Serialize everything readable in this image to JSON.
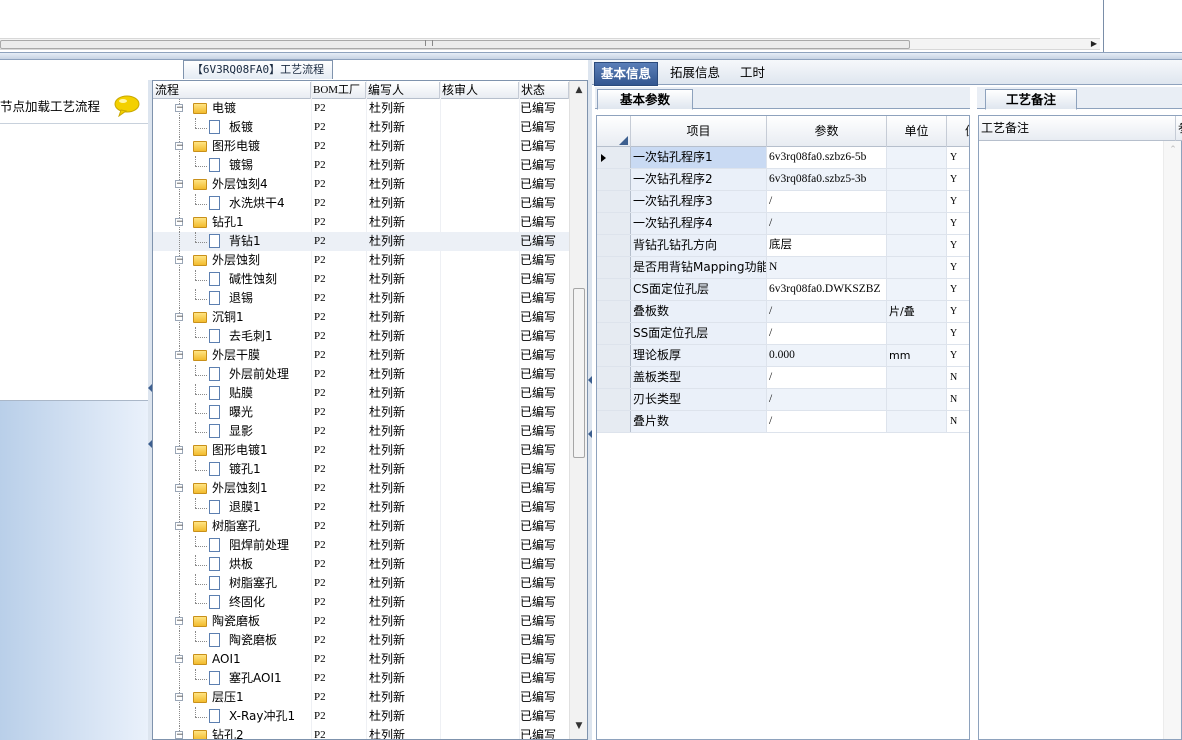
{
  "colors": {
    "frame_border": "#7f93ad",
    "tab_active_bg": "#3e639b",
    "tab_active_text": "#ffffff",
    "left_panel_gradient_start": "#b9cfe9",
    "folder_yellow": "#f2bb2d",
    "item_cell_bg": "#eaf0f9"
  },
  "left_panel": {
    "title": "节点加载工艺流程",
    "icon": "speech-bubble-icon"
  },
  "tree_panel": {
    "tab_label": "【6V3RQ08FA0】工艺流程",
    "columns": [
      "流程",
      "BOM工厂",
      "编写人",
      "核审人",
      "状态"
    ],
    "rows": [
      {
        "level": 1,
        "kind": "folder",
        "label": "电镀",
        "bom": "P2",
        "writer": "杜列新",
        "reviewer": "",
        "status": "已编写"
      },
      {
        "level": 2,
        "kind": "doc",
        "label": "板镀",
        "bom": "P2",
        "writer": "杜列新",
        "reviewer": "",
        "status": "已编写"
      },
      {
        "level": 1,
        "kind": "folder",
        "label": "图形电镀",
        "bom": "P2",
        "writer": "杜列新",
        "reviewer": "",
        "status": "已编写"
      },
      {
        "level": 2,
        "kind": "doc",
        "label": "镀锡",
        "bom": "P2",
        "writer": "杜列新",
        "reviewer": "",
        "status": "已编写"
      },
      {
        "level": 1,
        "kind": "folder",
        "label": "外层蚀刻4",
        "bom": "P2",
        "writer": "杜列新",
        "reviewer": "",
        "status": "已编写"
      },
      {
        "level": 2,
        "kind": "doc",
        "label": "水洗烘干4",
        "bom": "P2",
        "writer": "杜列新",
        "reviewer": "",
        "status": "已编写"
      },
      {
        "level": 1,
        "kind": "folder",
        "label": "钻孔1",
        "bom": "P2",
        "writer": "杜列新",
        "reviewer": "",
        "status": "已编写"
      },
      {
        "level": 2,
        "kind": "doc",
        "label": "背钻1",
        "bom": "P2",
        "writer": "杜列新",
        "reviewer": "",
        "status": "已编写",
        "selected": true
      },
      {
        "level": 1,
        "kind": "folder",
        "label": "外层蚀刻",
        "bom": "P2",
        "writer": "杜列新",
        "reviewer": "",
        "status": "已编写"
      },
      {
        "level": 2,
        "kind": "doc",
        "label": "碱性蚀刻",
        "bom": "P2",
        "writer": "杜列新",
        "reviewer": "",
        "status": "已编写"
      },
      {
        "level": 2,
        "kind": "doc",
        "label": "退锡",
        "bom": "P2",
        "writer": "杜列新",
        "reviewer": "",
        "status": "已编写"
      },
      {
        "level": 1,
        "kind": "folder",
        "label": "沉铜1",
        "bom": "P2",
        "writer": "杜列新",
        "reviewer": "",
        "status": "已编写"
      },
      {
        "level": 2,
        "kind": "doc",
        "label": "去毛刺1",
        "bom": "P2",
        "writer": "杜列新",
        "reviewer": "",
        "status": "已编写"
      },
      {
        "level": 1,
        "kind": "folder",
        "label": "外层干膜",
        "bom": "P2",
        "writer": "杜列新",
        "reviewer": "",
        "status": "已编写"
      },
      {
        "level": 2,
        "kind": "doc",
        "label": "外层前处理",
        "bom": "P2",
        "writer": "杜列新",
        "reviewer": "",
        "status": "已编写"
      },
      {
        "level": 2,
        "kind": "doc",
        "label": "贴膜",
        "bom": "P2",
        "writer": "杜列新",
        "reviewer": "",
        "status": "已编写"
      },
      {
        "level": 2,
        "kind": "doc",
        "label": "曝光",
        "bom": "P2",
        "writer": "杜列新",
        "reviewer": "",
        "status": "已编写"
      },
      {
        "level": 2,
        "kind": "doc",
        "label": "显影",
        "bom": "P2",
        "writer": "杜列新",
        "reviewer": "",
        "status": "已编写"
      },
      {
        "level": 1,
        "kind": "folder",
        "label": "图形电镀1",
        "bom": "P2",
        "writer": "杜列新",
        "reviewer": "",
        "status": "已编写"
      },
      {
        "level": 2,
        "kind": "doc",
        "label": "镀孔1",
        "bom": "P2",
        "writer": "杜列新",
        "reviewer": "",
        "status": "已编写"
      },
      {
        "level": 1,
        "kind": "folder",
        "label": "外层蚀刻1",
        "bom": "P2",
        "writer": "杜列新",
        "reviewer": "",
        "status": "已编写"
      },
      {
        "level": 2,
        "kind": "doc",
        "label": "退膜1",
        "bom": "P2",
        "writer": "杜列新",
        "reviewer": "",
        "status": "已编写"
      },
      {
        "level": 1,
        "kind": "folder",
        "label": "树脂塞孔",
        "bom": "P2",
        "writer": "杜列新",
        "reviewer": "",
        "status": "已编写"
      },
      {
        "level": 2,
        "kind": "doc",
        "label": "阻焊前处理",
        "bom": "P2",
        "writer": "杜列新",
        "reviewer": "",
        "status": "已编写"
      },
      {
        "level": 2,
        "kind": "doc",
        "label": "烘板",
        "bom": "P2",
        "writer": "杜列新",
        "reviewer": "",
        "status": "已编写"
      },
      {
        "level": 2,
        "kind": "doc",
        "label": "树脂塞孔",
        "bom": "P2",
        "writer": "杜列新",
        "reviewer": "",
        "status": "已编写"
      },
      {
        "level": 2,
        "kind": "doc",
        "label": "终固化",
        "bom": "P2",
        "writer": "杜列新",
        "reviewer": "",
        "status": "已编写"
      },
      {
        "level": 1,
        "kind": "folder",
        "label": "陶瓷磨板",
        "bom": "P2",
        "writer": "杜列新",
        "reviewer": "",
        "status": "已编写"
      },
      {
        "level": 2,
        "kind": "doc",
        "label": "陶瓷磨板",
        "bom": "P2",
        "writer": "杜列新",
        "reviewer": "",
        "status": "已编写"
      },
      {
        "level": 1,
        "kind": "folder",
        "label": "AOI1",
        "bom": "P2",
        "writer": "杜列新",
        "reviewer": "",
        "status": "已编写"
      },
      {
        "level": 2,
        "kind": "doc",
        "label": "塞孔AOI1",
        "bom": "P2",
        "writer": "杜列新",
        "reviewer": "",
        "status": "已编写"
      },
      {
        "level": 1,
        "kind": "folder",
        "label": "层压1",
        "bom": "P2",
        "writer": "杜列新",
        "reviewer": "",
        "status": "已编写"
      },
      {
        "level": 2,
        "kind": "doc",
        "label": "X-Ray冲孔1",
        "bom": "P2",
        "writer": "杜列新",
        "reviewer": "",
        "status": "已编写"
      },
      {
        "level": 1,
        "kind": "folder",
        "label": "钻孔2",
        "bom": "P2",
        "writer": "杜列新",
        "reviewer": "",
        "status": "已编写"
      }
    ]
  },
  "top_tabs": [
    "基本信息",
    "拓展信息",
    "工时"
  ],
  "basic_panel": {
    "tab_label": "基本参数",
    "columns": [
      "项目",
      "参数",
      "单位",
      "值"
    ],
    "rows": [
      {
        "item": "一次钻孔程序1",
        "value": "6v3rq08fa0.szbz6-5b",
        "unit": "",
        "flag": "Y",
        "current": true
      },
      {
        "item": "一次钻孔程序2",
        "value": "6v3rq08fa0.szbz5-3b",
        "unit": "",
        "flag": "Y"
      },
      {
        "item": "一次钻孔程序3",
        "value": "/",
        "unit": "",
        "flag": "Y"
      },
      {
        "item": "一次钻孔程序4",
        "value": "/",
        "unit": "",
        "flag": "Y"
      },
      {
        "item": "背钻孔钻孔方向",
        "value": "底层",
        "unit": "",
        "flag": "Y"
      },
      {
        "item": "是否用背钻Mapping功能",
        "value": "N",
        "unit": "",
        "flag": "Y"
      },
      {
        "item": "CS面定位孔层",
        "value": "6v3rq08fa0.DWKSZBZ",
        "unit": "",
        "flag": "Y"
      },
      {
        "item": "叠板数",
        "value": "/",
        "unit": "片/叠",
        "flag": "Y"
      },
      {
        "item": "SS面定位孔层",
        "value": "/",
        "unit": "",
        "flag": "Y"
      },
      {
        "item": "理论板厚",
        "value": "0.000",
        "unit": "mm",
        "flag": "Y"
      },
      {
        "item": "盖板类型",
        "value": "/",
        "unit": "",
        "flag": "N"
      },
      {
        "item": "刃长类型",
        "value": "/",
        "unit": "",
        "flag": "N"
      },
      {
        "item": "叠片数",
        "value": "/",
        "unit": "",
        "flag": "N"
      }
    ]
  },
  "remark_panel": {
    "tab_label": "工艺备注",
    "column": "工艺备注",
    "extra_column": "参"
  }
}
